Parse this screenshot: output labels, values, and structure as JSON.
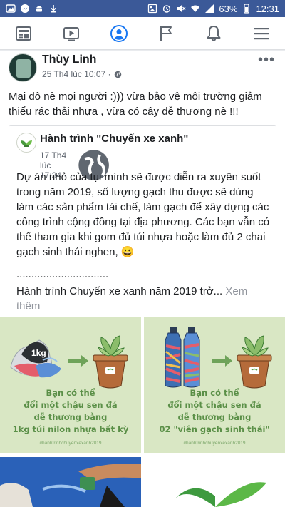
{
  "status_bar": {
    "battery": "63%",
    "time": "12:31",
    "icons": [
      "photo-icon",
      "messenger-icon",
      "alarm-icon",
      "mute-icon",
      "wifi-icon",
      "signal-icon",
      "battery-icon",
      "android-icon",
      "download-icon"
    ]
  },
  "nav": {
    "items": [
      "news-feed-icon",
      "watch-icon",
      "profile-icon",
      "pages-icon",
      "notifications-icon",
      "menu-icon"
    ],
    "active": "profile-icon",
    "accent": "#1877f2",
    "inactive_color": "#606770"
  },
  "post": {
    "author": "Thùy Linh",
    "timestamp": "25 Th4 lúc 10:07 ·",
    "text": "Mại dô nè mọi người :))) vừa bảo vệ môi trường giảm thiểu rác thải nhựa , vừa có cây dễ thương nè !!!",
    "more_label": "•••"
  },
  "shared": {
    "page_name": "Hành trình \"Chuyến xe xanh\"",
    "timestamp": "17 Th4 lúc 17:34 ·",
    "text": "Dự án nhỏ của tụi mình sẽ được diễn ra xuyên suốt trong năm 2019, số lượng gạch thu được sẽ dùng làm các sản phẩm tái chế, làm gạch để xây dựng các công trình cộng đồng tại địa phương. Các bạn vẫn có thể tham gia khi gom đủ túi nhựa hoặc làm đủ 2 chai gạch sinh thái nghen, 😀",
    "dots": "...............................",
    "more_text": "Hành trình Chuyến xe xanh năm 2019 trở...",
    "see_more": "Xem thêm"
  },
  "tiles": [
    {
      "label_bag": "1kg",
      "caption": [
        "Bạn có thể",
        "đổi một chậu sen đá",
        "dễ thương bằng",
        "1kg túi nilon nhựa bất kỳ"
      ],
      "hashtag": "#hanhtrinhchuyenxexanh2019"
    },
    {
      "caption": [
        "Bạn có thể",
        "đổi một chậu sen đá",
        "dễ thương bằng",
        "02 \"viên gạch sinh thái\""
      ],
      "hashtag": "#hanhtrinhchuyenxexanh2019"
    }
  ],
  "colors": {
    "facebook_blue": "#3b5998",
    "tile_bg": "#d9e7c4",
    "tile_text": "#5a8f47"
  }
}
